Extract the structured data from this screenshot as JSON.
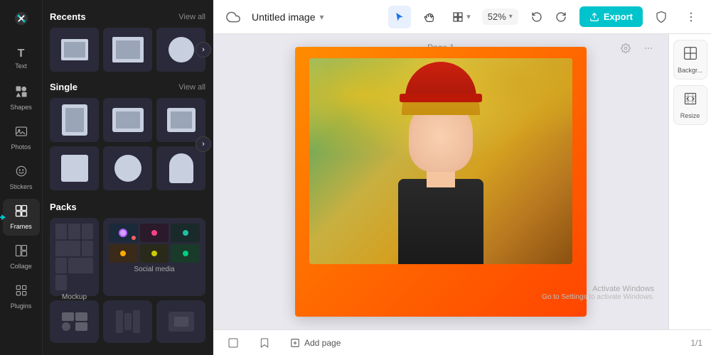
{
  "app": {
    "logo_text": "✂",
    "title": "Untitled image",
    "title_chevron": "▾"
  },
  "header": {
    "title": "Untitled image",
    "zoom_label": "52%",
    "export_label": "Export",
    "page_label": "Page 1",
    "page_counter": "1/1"
  },
  "nav": {
    "items": [
      {
        "id": "text",
        "icon": "T",
        "label": "Text"
      },
      {
        "id": "shapes",
        "icon": "⬡",
        "label": "Shapes"
      },
      {
        "id": "photos",
        "icon": "🖼",
        "label": "Photos"
      },
      {
        "id": "stickers",
        "icon": "😊",
        "label": "Stickers"
      },
      {
        "id": "frames",
        "icon": "⬜",
        "label": "Frames",
        "active": true
      },
      {
        "id": "collage",
        "icon": "⊞",
        "label": "Collage"
      },
      {
        "id": "plugins",
        "icon": "⚡",
        "label": "Plugins"
      }
    ]
  },
  "panels": {
    "recents": {
      "title": "Recents",
      "view_all": "View all"
    },
    "single": {
      "title": "Single",
      "view_all": "View all"
    },
    "packs": {
      "title": "Packs",
      "items": [
        {
          "label": "Mockup"
        },
        {
          "label": "Social media"
        }
      ]
    }
  },
  "right_panel": {
    "buttons": [
      {
        "id": "background",
        "icon": "▣",
        "label": "Backgr..."
      },
      {
        "id": "resize",
        "icon": "⤢",
        "label": "Resize"
      }
    ]
  },
  "bottom": {
    "add_page_label": "Add page"
  },
  "activate_windows": {
    "line1": "Activate Windows",
    "line2": "Go to Settings to activate Windows."
  }
}
